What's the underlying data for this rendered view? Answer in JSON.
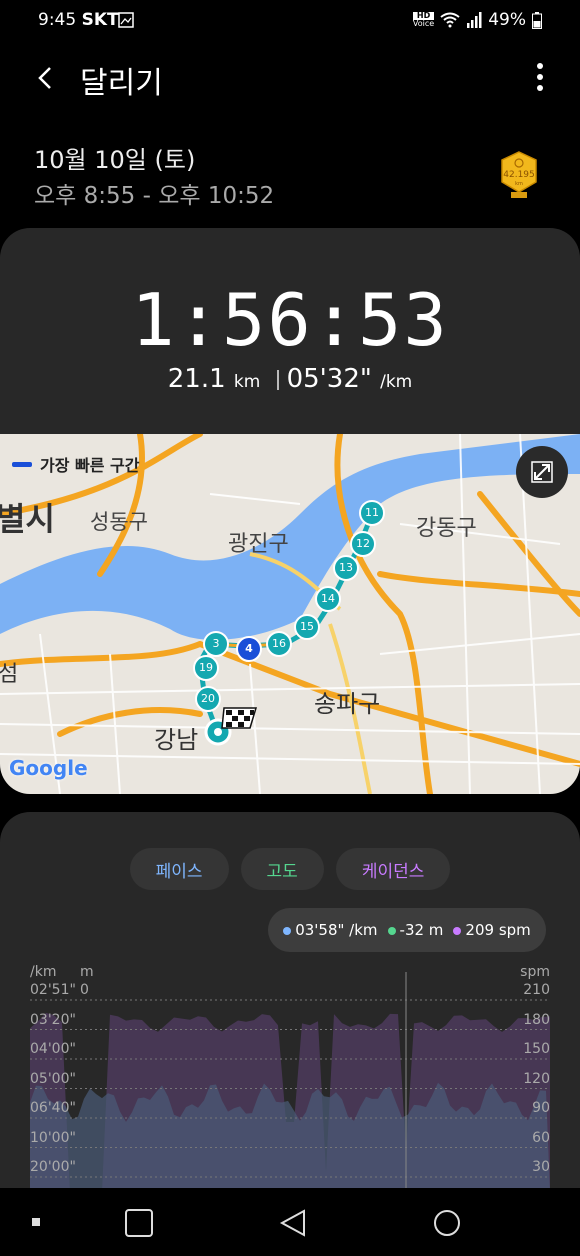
{
  "status": {
    "time": "9:45",
    "carrier": "SKT",
    "battery": "49%",
    "hd": "HD",
    "voice": "Voice"
  },
  "header": {
    "title": "달리기"
  },
  "session": {
    "date": "10월 10일 (토)",
    "time_range": "오후 8:55 - 오후 10:52",
    "medal_label": "42.195",
    "medal_unit": "km"
  },
  "summary": {
    "duration": "1:56:53",
    "distance": "21.1",
    "distance_unit": "km",
    "pace": "05'32\"",
    "pace_unit": "/km"
  },
  "map": {
    "legend_label": "가장 빠른 구간",
    "labels": [
      "별시",
      "성동구",
      "광진구",
      "강동구",
      "송파구",
      "강남",
      "섬"
    ],
    "google": "Google",
    "markers": [
      "3",
      "4",
      "11",
      "12",
      "13",
      "14",
      "15",
      "16",
      "19",
      "20"
    ]
  },
  "tabs": [
    {
      "label": "페이스",
      "color": "#7fb6ff"
    },
    {
      "label": "고도",
      "color": "#55d68f"
    },
    {
      "label": "케이던스",
      "color": "#c87bff"
    }
  ],
  "tooltip": {
    "pace": "03'58\" /km",
    "altitude": "-32 m",
    "cadence": "209 spm"
  },
  "chart_data": {
    "type": "area",
    "pace_axis": {
      "label": "/km",
      "ticks": [
        "02'51\"",
        "03'20\"",
        "04'00\"",
        "05'00\"",
        "06'40\"",
        "10'00\"",
        "20'00\""
      ]
    },
    "altitude_axis": {
      "label": "m",
      "ticks": [
        "0"
      ]
    },
    "cadence_axis": {
      "label": "spm",
      "ticks": [
        "210",
        "180",
        "150",
        "120",
        "90",
        "60",
        "30"
      ]
    }
  },
  "colors": {
    "pace": "#7fb6ff",
    "altitude": "#55d68f",
    "cadence": "#c87bff",
    "route": "#14a8b0",
    "fastest": "#1a4fd8"
  }
}
